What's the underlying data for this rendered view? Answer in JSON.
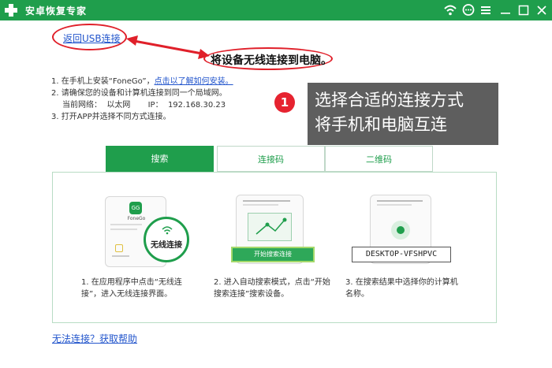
{
  "app": {
    "title": "安卓恢复专家"
  },
  "titlebar_icons": [
    "wifi-icon",
    "chat-icon",
    "menu-icon",
    "minimize-icon",
    "maximize-icon",
    "close-icon"
  ],
  "top": {
    "back_link": "返回USB连接",
    "page_title": "将设备无线连接到电脑。"
  },
  "steps": {
    "s1_text": "1.  在手机上安装“FoneGo”，",
    "s1_link": "点击以了解如何安装。",
    "s2_text": "2.  请确保您的设备和计算机连接到同一个局域网。",
    "s2_network": "当前网络：  以太网       IP：  192.168.30.23",
    "s3_text": "3.  打开APP并选择不同方式连接。"
  },
  "callout": {
    "number": "1",
    "line1": "选择合适的连接方式",
    "line2": "将手机和电脑互连"
  },
  "tabs": [
    "搜索",
    "连接码",
    "二维码"
  ],
  "active_tab": 0,
  "cards": [
    {
      "phone_title": "FoneGo",
      "bubble_label": "无线连接",
      "caption": "1.  在应用程序中点击“无线连接”，进入无线连接界面。"
    },
    {
      "button_label": "开始搜索连接",
      "caption": "2.  进入自动搜索模式，点击“开始搜索连接”搜索设备。"
    },
    {
      "device_name": "DESKTOP-VFSHPVC",
      "caption": "3.  在搜索结果中选择你的计算机名称。"
    }
  ],
  "footer": {
    "help_link": "无法连接？获取帮助"
  },
  "colors": {
    "brand_green": "#1f9e4c",
    "annotation_red": "#e0202a",
    "callout_gray": "#5e5e5e",
    "link_blue": "#2255cc"
  }
}
